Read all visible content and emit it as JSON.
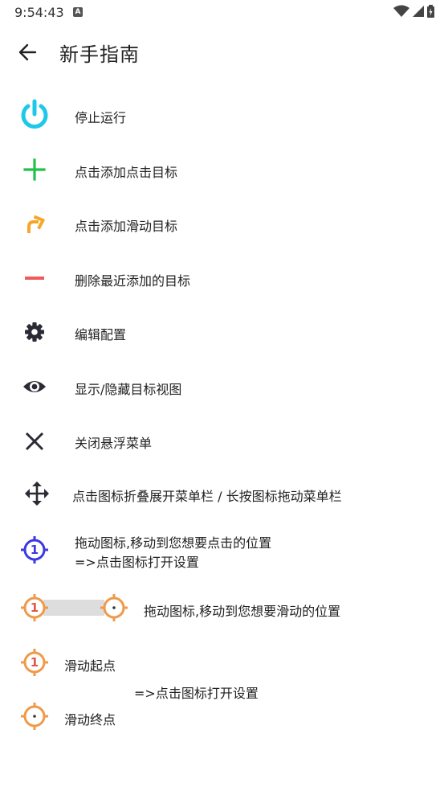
{
  "status_bar": {
    "time": "9:54:43",
    "notif_letter": "A"
  },
  "app_bar": {
    "title": "新手指南"
  },
  "items": [
    {
      "label": "停止运行",
      "icon": "power-icon",
      "color": "#1ec8e8"
    },
    {
      "label": "点击添加点击目标",
      "icon": "plus-icon",
      "color": "#22c14a"
    },
    {
      "label": "点击添加滑动目标",
      "icon": "swipe-arrow-icon",
      "color": "#f4a829"
    },
    {
      "label": "删除最近添加的目标",
      "icon": "minus-icon",
      "color": "#f05a5a"
    },
    {
      "label": "编辑配置",
      "icon": "gear-icon",
      "color": "#2b2b35"
    },
    {
      "label": "显示/隐藏目标视图",
      "icon": "eye-icon",
      "color": "#2b2b35"
    },
    {
      "label": "关闭悬浮菜单",
      "icon": "close-icon",
      "color": "#2b2b35"
    },
    {
      "label": "点击图标折叠展开菜单栏 / 长按图标拖动菜单栏",
      "icon": "move-icon",
      "color": "#2b2b35"
    }
  ],
  "click_target": {
    "line1": "拖动图标,移动到您想要点击的位置",
    "line2": "=>点击图标打开设置",
    "number": "1",
    "color": "#3a3ae0"
  },
  "swipe_target": {
    "text": "拖动图标,移动到您想要滑动的位置",
    "start_number": "1",
    "color": "#ef9a4a"
  },
  "swipe_detail": {
    "start_label": "滑动起点",
    "settings_hint": "=>点击图标打开设置",
    "end_label": "滑动终点"
  }
}
